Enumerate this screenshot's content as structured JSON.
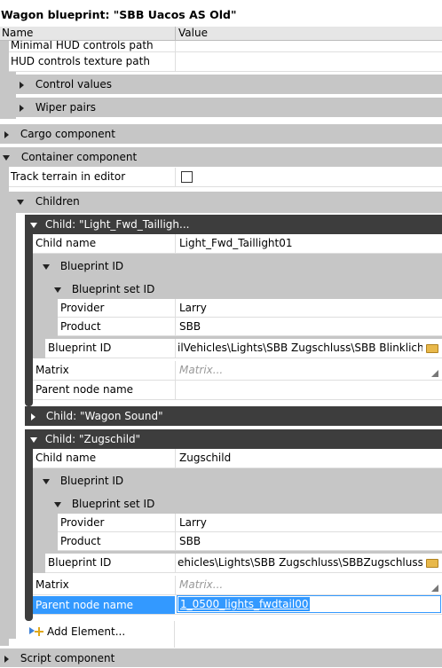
{
  "window_title": "Wagon blueprint: \"SBB Uacos AS Old\"",
  "columns": {
    "name": "Name",
    "value": "Value"
  },
  "rows": {
    "minimal_hud": "Minimal HUD controls path",
    "hud_texture": "HUD controls texture path",
    "control_values": "Control values",
    "wiper_pairs": "Wiper pairs",
    "cargo": "Cargo component",
    "container": "Container component",
    "track_terrain": "Track terrain in editor",
    "children": "Children",
    "child1": {
      "header": "Child: \"Light_Fwd_Tailligh...",
      "child_name_label": "Child name",
      "child_name_value": "Light_Fwd_Taillight01",
      "blueprint_id_group": "Blueprint ID",
      "blueprint_set_id": "Blueprint set ID",
      "provider_label": "Provider",
      "provider_value": "Larry",
      "product_label": "Product",
      "product_value": "SBB",
      "blueprint_id_label": "Blueprint ID",
      "blueprint_id_value": "ilVehicles\\Lights\\SBB Zugschluss\\SBB Blinklicht.xml",
      "matrix_label": "Matrix",
      "matrix_value": "Matrix...",
      "parent_node_label": "Parent node name",
      "parent_node_value": ""
    },
    "child2_header": "Child: \"Wagon Sound\"",
    "child3": {
      "header": "Child: \"Zugschild\"",
      "child_name_label": "Child name",
      "child_name_value": "Zugschild",
      "blueprint_id_group": "Blueprint ID",
      "blueprint_set_id": "Blueprint set ID",
      "provider_label": "Provider",
      "provider_value": "Larry",
      "product_label": "Product",
      "product_value": "SBB",
      "blueprint_id_label": "Blueprint ID",
      "blueprint_id_value": "ehicles\\Lights\\SBB Zugschluss\\SBBZugschlussG.xml",
      "matrix_label": "Matrix",
      "matrix_value": "Matrix...",
      "parent_node_label": "Parent node name",
      "parent_node_value": "1_0500_lights_fwdtail00"
    },
    "add_element": "Add Element...",
    "script": "Script component"
  },
  "icons": {
    "expand": "triangle-right-icon",
    "collapse": "triangle-down-icon",
    "browse": "folder-icon",
    "add": "add-element-icon",
    "dropdown": "dropdown-corner-icon"
  },
  "colors": {
    "category": "#c6c6c6",
    "child_header": "#3d3d3d",
    "selection": "#3399ff"
  }
}
